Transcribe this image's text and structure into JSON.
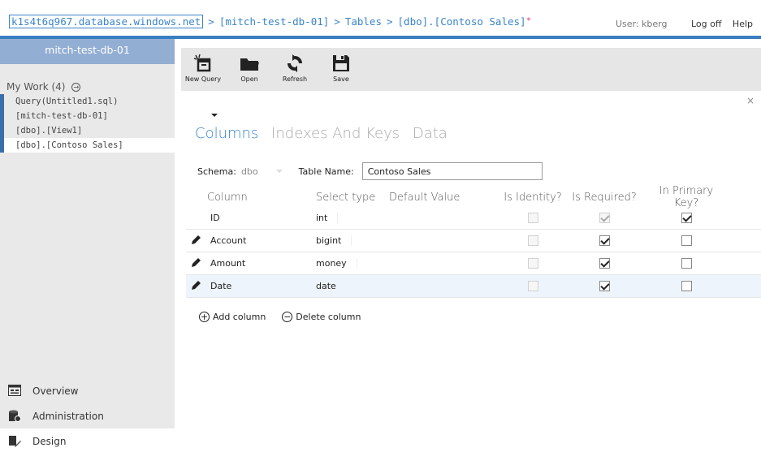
{
  "header": {
    "server": "k1s4t6q967.database.windows.net",
    "sep": ">",
    "crumbs": [
      "[mitch-test-db-01]",
      "Tables",
      "[dbo].[Contoso Sales]"
    ],
    "dirty_mark": "*",
    "user_label": "User: kberg",
    "logoff_label": "Log off",
    "help_label": "Help"
  },
  "sidebar": {
    "db_title": "mitch-test-db-01",
    "mywork_label": "My Work (4)",
    "items": [
      "Query(Untitled1.sql)",
      "[mitch-test-db-01]",
      "[dbo].[View1]",
      "[dbo].[Contoso Sales]"
    ],
    "bottom": [
      "Overview",
      "Administration",
      "Design"
    ]
  },
  "ribbon": {
    "new_query": "New Query",
    "open": "Open",
    "refresh": "Refresh",
    "save": "Save"
  },
  "close_glyph": "×",
  "tabs": [
    "Columns",
    "Indexes And Keys",
    "Data"
  ],
  "schema": {
    "schema_label": "Schema:",
    "schema_value": "dbo",
    "table_name_label": "Table Name:",
    "table_name_value": "Contoso Sales"
  },
  "grid": {
    "headers": [
      "Column",
      "Select type",
      "Default Value",
      "Is Identity?",
      "Is Required?",
      "In Primary Key?"
    ],
    "rows": [
      {
        "name": "ID",
        "type": "int",
        "identity": false,
        "required": true,
        "pk": true,
        "editable": false
      },
      {
        "name": "Account",
        "type": "bigint",
        "identity": false,
        "required": true,
        "pk": false,
        "editable": true
      },
      {
        "name": "Amount",
        "type": "money",
        "identity": false,
        "required": true,
        "pk": false,
        "editable": true
      },
      {
        "name": "Date",
        "type": "date",
        "identity": false,
        "required": true,
        "pk": false,
        "editable": true
      }
    ]
  },
  "actions": {
    "add_column": "Add column",
    "delete_column": "Delete column"
  },
  "colors": {
    "accent": "#3a84c9",
    "sidebar_title": "#93aed3",
    "strip": "#3a7dc0"
  }
}
